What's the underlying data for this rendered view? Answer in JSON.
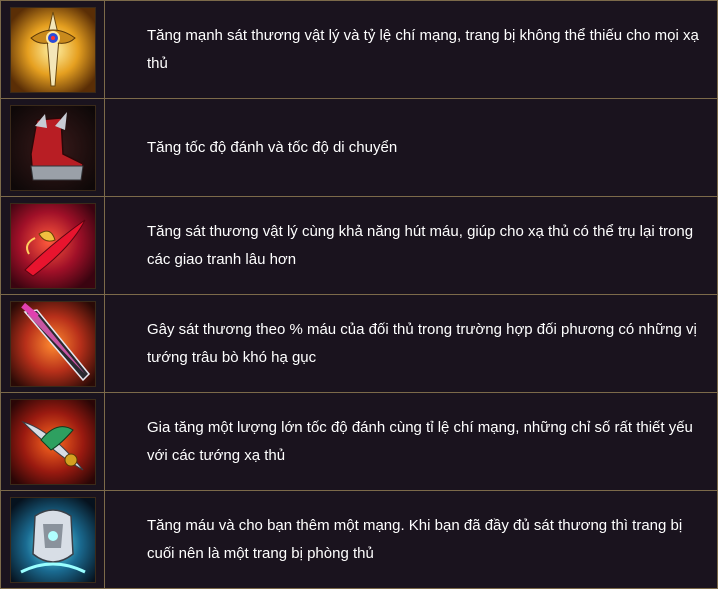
{
  "items": [
    {
      "icon": "golden-sword-icon",
      "description": "Tăng mạnh sát thương vật lý và tỷ lệ chí mạng, trang bị không thể thiếu cho mọi xạ thủ"
    },
    {
      "icon": "red-boots-icon",
      "description": "Tăng tốc độ đánh và tốc độ di chuyển"
    },
    {
      "icon": "crimson-blade-icon",
      "description": "Tăng sát thương vật lý cùng khả năng hút máu, giúp cho xạ thủ có thể trụ lại trong các giao tranh lâu hơn"
    },
    {
      "icon": "pink-dagger-icon",
      "description": "Gây sát thương theo % máu của đối thủ trong trường hợp đối phương có những vị tướng trâu bò khó hạ gục"
    },
    {
      "icon": "jade-fang-blade-icon",
      "description": "Gia tăng một lượng lớn tốc độ đánh cùng tỉ lệ chí mạng, những chỉ số rất thiết yếu với các tướng xạ thủ"
    },
    {
      "icon": "silver-armor-icon",
      "description": "Tăng máu và cho bạn thêm một mạng. Khi bạn đã đầy đủ sát thương thì trang bị cuối nên là một trang bị phòng thủ"
    }
  ]
}
